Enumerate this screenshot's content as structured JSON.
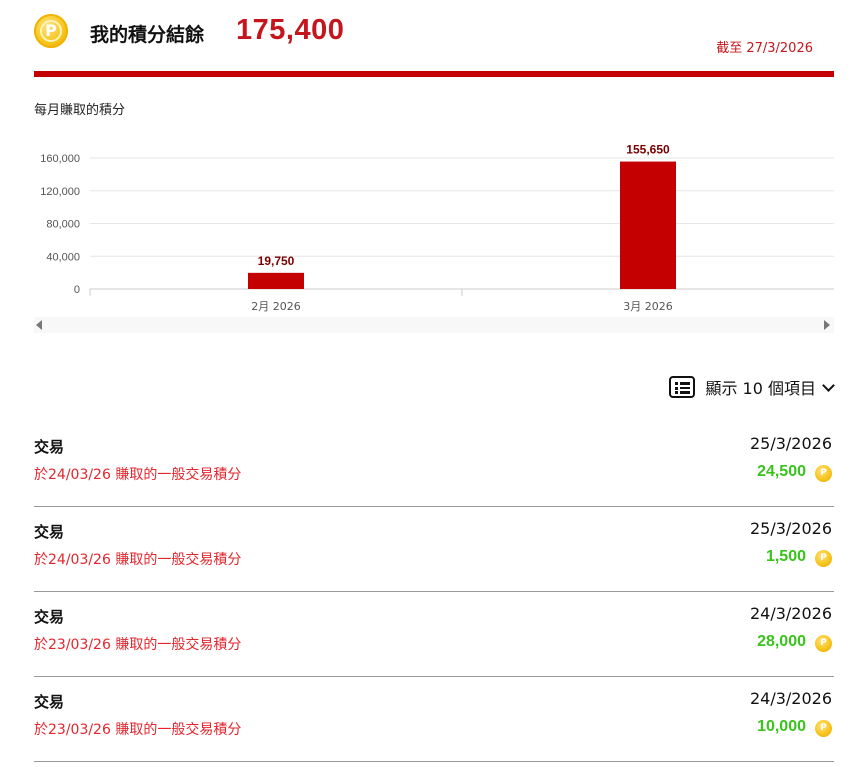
{
  "header": {
    "coin_icon": "point-coin-icon",
    "coin_letter": "P",
    "balance_label": "我的積分結餘",
    "balance_value": "175,400",
    "as_of": "截至 27/3/2026",
    "accent_color": "#c40000"
  },
  "chart_title": "每月賺取的積分",
  "chart_data": {
    "type": "bar",
    "categories": [
      "2月 2026",
      "3月 2026"
    ],
    "values": [
      19750,
      155650
    ],
    "value_labels": [
      "19,750",
      "155,650"
    ],
    "ylim": [
      0,
      160000
    ],
    "yticks": [
      0,
      40000,
      80000,
      120000,
      160000
    ],
    "ytick_labels": [
      "0",
      "40,000",
      "80,000",
      "120,000",
      "160,000"
    ],
    "grid": true,
    "bar_color": "#c40000",
    "label_color": "#7a0000"
  },
  "list_control": {
    "icon": "list-icon",
    "label": "顯示 10 個項目",
    "chevron": "chevron-down-icon"
  },
  "transactions": [
    {
      "type": "交易",
      "description": "於24/03/26 賺取的一般交易積分",
      "date": "25/3/2026",
      "points": "24,500"
    },
    {
      "type": "交易",
      "description": "於24/03/26 賺取的一般交易積分",
      "date": "25/3/2026",
      "points": "1,500"
    },
    {
      "type": "交易",
      "description": "於23/03/26 賺取的一般交易積分",
      "date": "24/3/2026",
      "points": "28,000"
    },
    {
      "type": "交易",
      "description": "於23/03/26 賺取的一般交易積分",
      "date": "24/3/2026",
      "points": "10,000"
    }
  ]
}
